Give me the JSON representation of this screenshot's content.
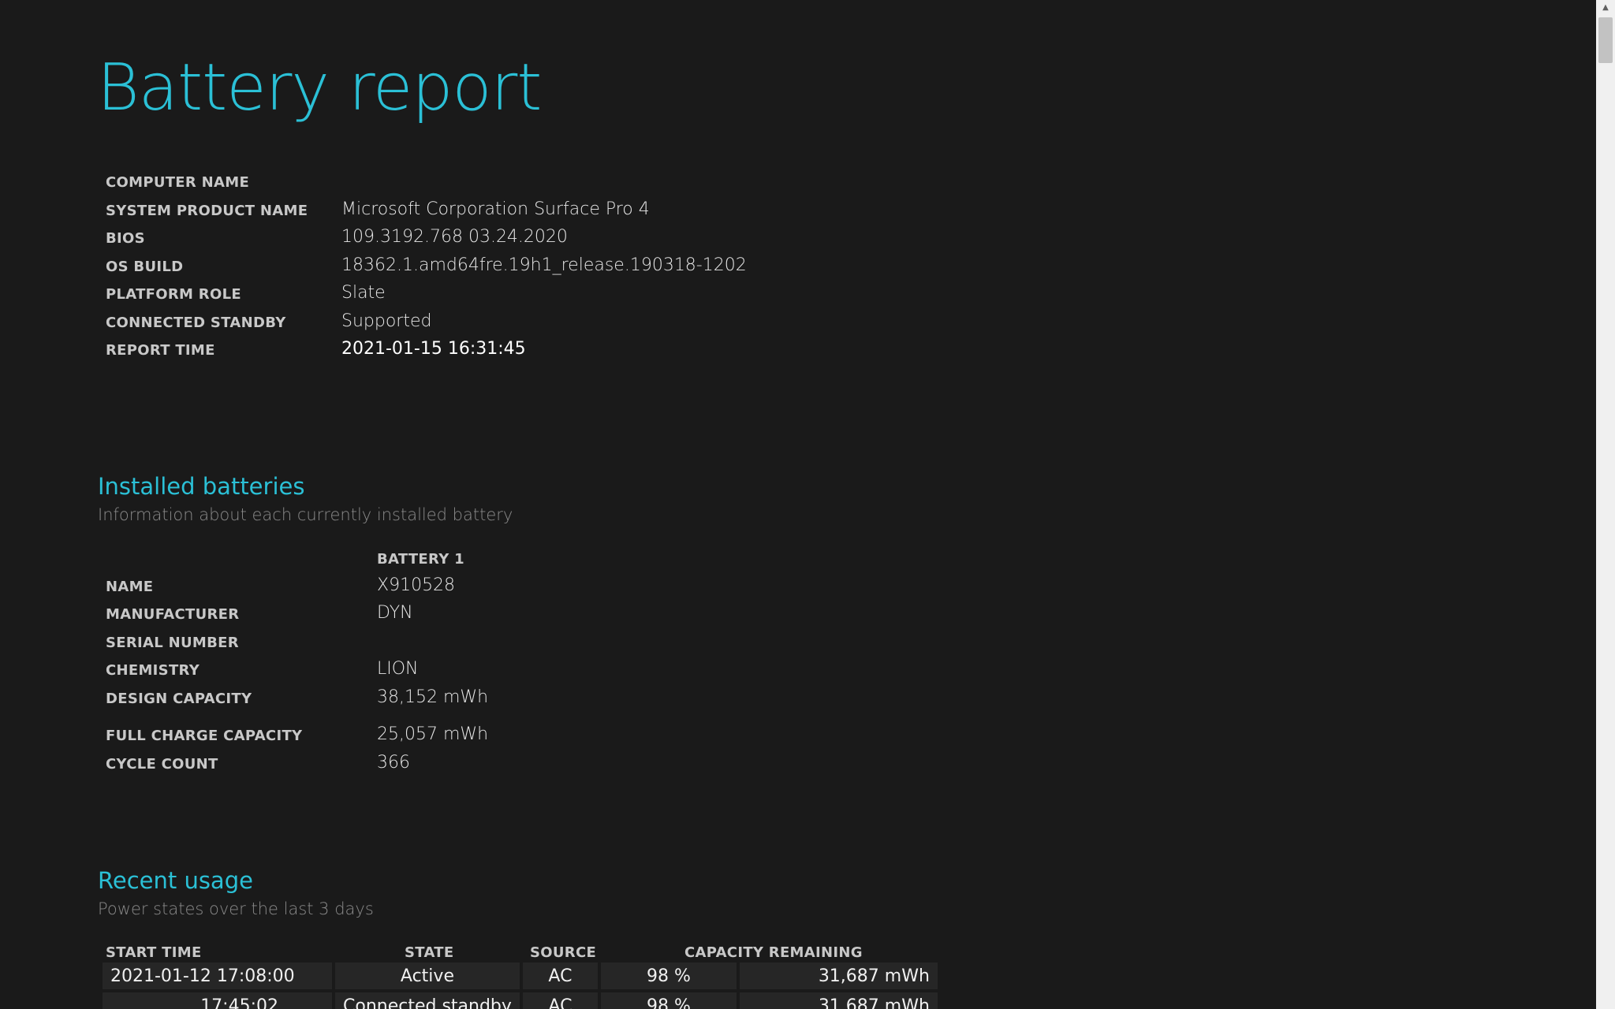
{
  "report": {
    "title": "Battery report"
  },
  "system_info": [
    {
      "label": "COMPUTER NAME",
      "value": ""
    },
    {
      "label": "SYSTEM PRODUCT NAME",
      "value": "Microsoft Corporation Surface Pro 4"
    },
    {
      "label": "BIOS",
      "value": "109.3192.768 03.24.2020"
    },
    {
      "label": "OS BUILD",
      "value": "18362.1.amd64fre.19h1_release.190318-1202"
    },
    {
      "label": "PLATFORM ROLE",
      "value": "Slate"
    },
    {
      "label": "CONNECTED STANDBY",
      "value": "Supported"
    },
    {
      "label": "REPORT TIME",
      "value": "2021-01-15  16:31:45"
    }
  ],
  "installed_batteries": {
    "title": "Installed batteries",
    "subtitle": "Information about each currently installed battery",
    "column_header": "BATTERY 1",
    "rows": [
      {
        "label": "NAME",
        "value": "X910528"
      },
      {
        "label": "MANUFACTURER",
        "value": "DYN"
      },
      {
        "label": "SERIAL NUMBER",
        "value": ""
      },
      {
        "label": "CHEMISTRY",
        "value": "LION"
      },
      {
        "label": "DESIGN CAPACITY",
        "value": "38,152 mWh"
      },
      {
        "label": "FULL CHARGE CAPACITY",
        "value": "25,057 mWh"
      },
      {
        "label": "CYCLE COUNT",
        "value": "366"
      }
    ]
  },
  "recent_usage": {
    "title": "Recent usage",
    "subtitle": "Power states over the last 3 days",
    "headers": {
      "start_time": "START TIME",
      "state": "STATE",
      "source": "SOURCE",
      "capacity": "CAPACITY REMAINING"
    },
    "rows": [
      {
        "start_time": "2021-01-12  17:08:00",
        "state": "Active",
        "source": "AC",
        "percent": "98 %",
        "mwh": "31,687 mWh"
      },
      {
        "start_time": "17:45:02",
        "state": "Connected standby",
        "source": "AC",
        "percent": "98 %",
        "mwh": "31,687 mWh"
      }
    ]
  },
  "colors": {
    "background": "#1a1a1a",
    "accent": "#2bc0d6",
    "cell_background": "#262626"
  }
}
